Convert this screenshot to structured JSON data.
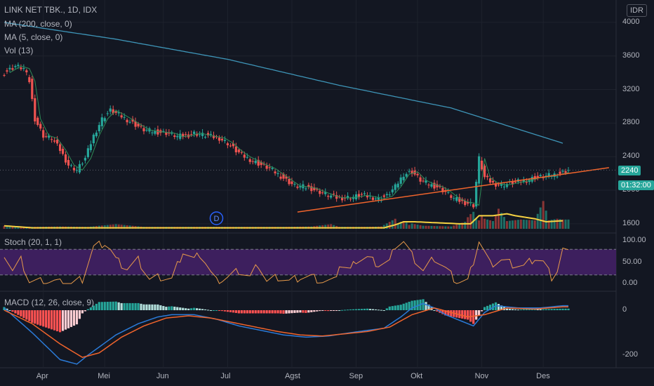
{
  "legend": {
    "title": "LINK NET TBK., 1D, IDX",
    "ma200": "MA (200, close, 0)",
    "ma5": "MA (5, close, 0)",
    "vol": "Vol (13)"
  },
  "currency_badge": "IDR",
  "stoch_label": "Stoch (20, 1, 1)",
  "macd_label": "MACD (12, 26, close, 9)",
  "price_pill": "2240",
  "time_pill": "01:32:00",
  "dividend_marker": "D",
  "colors": {
    "up": "#26a69a",
    "down": "#ef5350",
    "ma200": "#3e95b8",
    "ma_vol": "#f5d142",
    "trend": "#f0642c",
    "stoch_band": "#3d1f5e",
    "stoch_line": "#e89a4a",
    "macd_line": "#2b7bd8",
    "signal_line": "#f0642c"
  },
  "chart_data": {
    "type": "candlestick",
    "title": "LINK NET TBK., 1D, IDX",
    "x_labels": [
      "Apr",
      "Mei",
      "Jun",
      "Jul",
      "Agst",
      "Sep",
      "Okt",
      "Nov",
      "Des"
    ],
    "price_axis": {
      "ticks": [
        1600,
        2000,
        2400,
        2800,
        3200,
        3600,
        4000
      ],
      "ylim": [
        1540,
        4200
      ]
    },
    "stoch_axis": {
      "ticks": [
        "100.00",
        "50.00",
        "0.00"
      ],
      "band": [
        20,
        80
      ]
    },
    "macd_axis": {
      "ticks": [
        "0",
        "-200"
      ]
    },
    "close_anchors": [
      [
        0,
        3400
      ],
      [
        4,
        3480
      ],
      [
        7,
        3450
      ],
      [
        9,
        3300
      ],
      [
        11,
        2850
      ],
      [
        14,
        2650
      ],
      [
        17,
        2620
      ],
      [
        20,
        2480
      ],
      [
        23,
        2300
      ],
      [
        26,
        2240
      ],
      [
        29,
        2380
      ],
      [
        32,
        2650
      ],
      [
        35,
        2850
      ],
      [
        38,
        2950
      ],
      [
        41,
        2900
      ],
      [
        44,
        2840
      ],
      [
        47,
        2780
      ],
      [
        50,
        2720
      ],
      [
        53,
        2700
      ],
      [
        56,
        2690
      ],
      [
        59,
        2680
      ],
      [
        62,
        2640
      ],
      [
        65,
        2650
      ],
      [
        68,
        2680
      ],
      [
        71,
        2660
      ],
      [
        74,
        2640
      ],
      [
        77,
        2620
      ],
      [
        80,
        2560
      ],
      [
        83,
        2470
      ],
      [
        86,
        2400
      ],
      [
        89,
        2350
      ],
      [
        92,
        2300
      ],
      [
        95,
        2260
      ],
      [
        98,
        2190
      ],
      [
        101,
        2120
      ],
      [
        104,
        2050
      ],
      [
        107,
        2040
      ],
      [
        110,
        2020
      ],
      [
        113,
        1980
      ],
      [
        116,
        1940
      ],
      [
        119,
        1910
      ],
      [
        122,
        1910
      ],
      [
        125,
        1920
      ],
      [
        128,
        1940
      ],
      [
        131,
        1920
      ],
      [
        134,
        1900
      ],
      [
        137,
        1930
      ],
      [
        140,
        2040
      ],
      [
        143,
        2190
      ],
      [
        146,
        2220
      ],
      [
        149,
        2120
      ],
      [
        152,
        2070
      ],
      [
        155,
        2040
      ],
      [
        158,
        1980
      ],
      [
        161,
        1900
      ],
      [
        164,
        1860
      ],
      [
        167,
        1840
      ],
      [
        168,
        1820
      ],
      [
        170,
        2380
      ],
      [
        172,
        2150
      ],
      [
        175,
        2080
      ],
      [
        178,
        2060
      ],
      [
        181,
        2080
      ],
      [
        184,
        2100
      ],
      [
        187,
        2120
      ],
      [
        190,
        2150
      ],
      [
        193,
        2160
      ],
      [
        196,
        2180
      ],
      [
        199,
        2200
      ],
      [
        202,
        2240
      ]
    ],
    "ma200": [
      [
        0,
        4000
      ],
      [
        40,
        3800
      ],
      [
        80,
        3560
      ],
      [
        120,
        3250
      ],
      [
        160,
        2980
      ],
      [
        200,
        2560
      ]
    ],
    "trend_line": [
      [
        105,
        1740
      ],
      [
        209,
        2210
      ]
    ],
    "volume": [
      [
        0,
        8
      ],
      [
        10,
        5
      ],
      [
        20,
        6
      ],
      [
        30,
        5
      ],
      [
        40,
        12
      ],
      [
        50,
        5
      ],
      [
        60,
        5
      ],
      [
        70,
        5
      ],
      [
        80,
        5
      ],
      [
        90,
        5
      ],
      [
        100,
        5
      ],
      [
        110,
        6
      ],
      [
        117,
        12
      ],
      [
        120,
        5
      ],
      [
        130,
        5
      ],
      [
        135,
        6
      ],
      [
        140,
        26
      ],
      [
        141,
        14
      ],
      [
        142,
        18
      ],
      [
        143,
        20
      ],
      [
        144,
        16
      ],
      [
        145,
        10
      ],
      [
        146,
        14
      ],
      [
        147,
        12
      ],
      [
        150,
        8
      ],
      [
        160,
        6
      ],
      [
        165,
        18
      ],
      [
        166,
        30
      ],
      [
        167,
        38
      ],
      [
        168,
        44
      ],
      [
        169,
        28
      ],
      [
        170,
        22
      ],
      [
        171,
        34
      ],
      [
        172,
        26
      ],
      [
        175,
        20
      ],
      [
        177,
        52
      ],
      [
        180,
        20
      ],
      [
        185,
        24
      ],
      [
        190,
        22
      ],
      [
        193,
        72
      ],
      [
        195,
        22
      ],
      [
        198,
        26
      ],
      [
        200,
        24
      ]
    ],
    "vol_ma": [
      [
        0,
        6
      ],
      [
        10,
        2
      ],
      [
        30,
        2
      ],
      [
        60,
        2
      ],
      [
        90,
        2
      ],
      [
        120,
        2
      ],
      [
        136,
        2
      ],
      [
        140,
        8
      ],
      [
        143,
        14
      ],
      [
        147,
        14
      ],
      [
        155,
        12
      ],
      [
        163,
        10
      ],
      [
        167,
        10
      ],
      [
        170,
        26
      ],
      [
        175,
        26
      ],
      [
        180,
        30
      ],
      [
        183,
        26
      ],
      [
        190,
        20
      ],
      [
        194,
        14
      ],
      [
        200,
        16
      ]
    ],
    "stoch": [
      [
        0,
        70
      ],
      [
        3,
        30
      ],
      [
        6,
        55
      ],
      [
        9,
        5
      ],
      [
        12,
        5
      ],
      [
        15,
        5
      ],
      [
        18,
        5
      ],
      [
        21,
        0
      ],
      [
        24,
        0
      ],
      [
        28,
        10
      ],
      [
        32,
        85
      ],
      [
        36,
        95
      ],
      [
        38,
        80
      ],
      [
        40,
        55
      ],
      [
        44,
        35
      ],
      [
        48,
        55
      ],
      [
        52,
        10
      ],
      [
        56,
        15
      ],
      [
        60,
        10
      ],
      [
        64,
        75
      ],
      [
        68,
        55
      ],
      [
        70,
        70
      ],
      [
        72,
        50
      ],
      [
        74,
        25
      ],
      [
        76,
        5
      ],
      [
        80,
        15
      ],
      [
        84,
        30
      ],
      [
        88,
        15
      ],
      [
        91,
        45
      ],
      [
        94,
        5
      ],
      [
        98,
        15
      ],
      [
        102,
        5
      ],
      [
        106,
        15
      ],
      [
        110,
        15
      ],
      [
        114,
        5
      ],
      [
        118,
        5
      ],
      [
        120,
        45
      ],
      [
        124,
        30
      ],
      [
        126,
        55
      ],
      [
        130,
        60
      ],
      [
        134,
        45
      ],
      [
        138,
        50
      ],
      [
        140,
        90
      ],
      [
        143,
        98
      ],
      [
        146,
        65
      ],
      [
        150,
        30
      ],
      [
        154,
        60
      ],
      [
        158,
        35
      ],
      [
        162,
        5
      ],
      [
        166,
        5
      ],
      [
        170,
        100
      ],
      [
        174,
        45
      ],
      [
        178,
        55
      ],
      [
        182,
        45
      ],
      [
        186,
        40
      ],
      [
        190,
        60
      ],
      [
        193,
        50
      ],
      [
        196,
        15
      ],
      [
        198,
        30
      ],
      [
        200,
        80
      ],
      [
        202,
        70
      ]
    ],
    "macd": [
      [
        0,
        10
      ],
      [
        10,
        -100
      ],
      [
        20,
        -220
      ],
      [
        26,
        -240
      ],
      [
        30,
        -200
      ],
      [
        40,
        -110
      ],
      [
        48,
        -60
      ],
      [
        55,
        -30
      ],
      [
        60,
        -20
      ],
      [
        68,
        -20
      ],
      [
        76,
        -40
      ],
      [
        84,
        -70
      ],
      [
        92,
        -90
      ],
      [
        100,
        -110
      ],
      [
        108,
        -120
      ],
      [
        116,
        -115
      ],
      [
        124,
        -100
      ],
      [
        130,
        -90
      ],
      [
        136,
        -80
      ],
      [
        142,
        -30
      ],
      [
        146,
        10
      ],
      [
        150,
        30
      ],
      [
        154,
        10
      ],
      [
        158,
        -20
      ],
      [
        164,
        -50
      ],
      [
        168,
        -70
      ],
      [
        172,
        -10
      ],
      [
        176,
        20
      ],
      [
        184,
        10
      ],
      [
        192,
        10
      ],
      [
        200,
        20
      ]
    ],
    "signal": [
      [
        0,
        0
      ],
      [
        10,
        -60
      ],
      [
        20,
        -150
      ],
      [
        28,
        -210
      ],
      [
        34,
        -190
      ],
      [
        42,
        -120
      ],
      [
        50,
        -70
      ],
      [
        58,
        -35
      ],
      [
        66,
        -25
      ],
      [
        74,
        -35
      ],
      [
        82,
        -55
      ],
      [
        90,
        -75
      ],
      [
        98,
        -95
      ],
      [
        106,
        -110
      ],
      [
        114,
        -115
      ],
      [
        122,
        -105
      ],
      [
        130,
        -95
      ],
      [
        138,
        -75
      ],
      [
        146,
        -20
      ],
      [
        154,
        10
      ],
      [
        160,
        -10
      ],
      [
        166,
        -30
      ],
      [
        172,
        -20
      ],
      [
        180,
        10
      ],
      [
        190,
        5
      ],
      [
        200,
        15
      ]
    ]
  }
}
